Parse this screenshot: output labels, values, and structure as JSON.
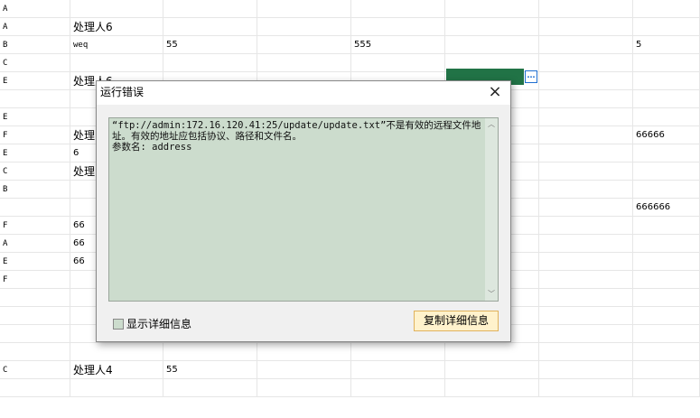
{
  "sheet": {
    "rows": [
      {
        "c0": "A"
      },
      {
        "c0": "A",
        "c1": "处理人6"
      },
      {
        "c0": "B",
        "c1": "weq",
        "c2": "55",
        "c4": "555",
        "c7": "5"
      },
      {
        "c0": "C"
      },
      {
        "c0": "E",
        "c1": "处理人6"
      },
      {
        "c0": ""
      },
      {
        "c0": "E"
      },
      {
        "c0": "F",
        "c1": "处理",
        "c7": "66666"
      },
      {
        "c0": "E",
        "c1": "6"
      },
      {
        "c0": "C",
        "c1": "处理"
      },
      {
        "c0": "B"
      },
      {
        "c0": "",
        "c7": "666666"
      },
      {
        "c0": "F",
        "c1": "66"
      },
      {
        "c0": "A",
        "c1": "66"
      },
      {
        "c0": "E",
        "c1": "66"
      },
      {
        "c0": "F"
      },
      {
        "c0": ""
      },
      {
        "c0": ""
      },
      {
        "c0": ""
      },
      {
        "c0": ""
      },
      {
        "c0": "C",
        "c1": "处理人4",
        "c2": "55"
      },
      {
        "c0": ""
      }
    ],
    "selected_fill_color": "#217346",
    "ellipsis_button": "…"
  },
  "dialog": {
    "title": "运行错误",
    "close_icon": "×",
    "message": "“ftp://admin:172.16.120.41:25/update/update.txt”不是有效的远程文件地址。有效的地址应包括协议、路径和文件名。\n参数名: address",
    "show_details_label": "显示详细信息",
    "copy_button_label": "复制详细信息",
    "message_bg": "#ccdccd",
    "button_bg": "#fff2cc"
  }
}
